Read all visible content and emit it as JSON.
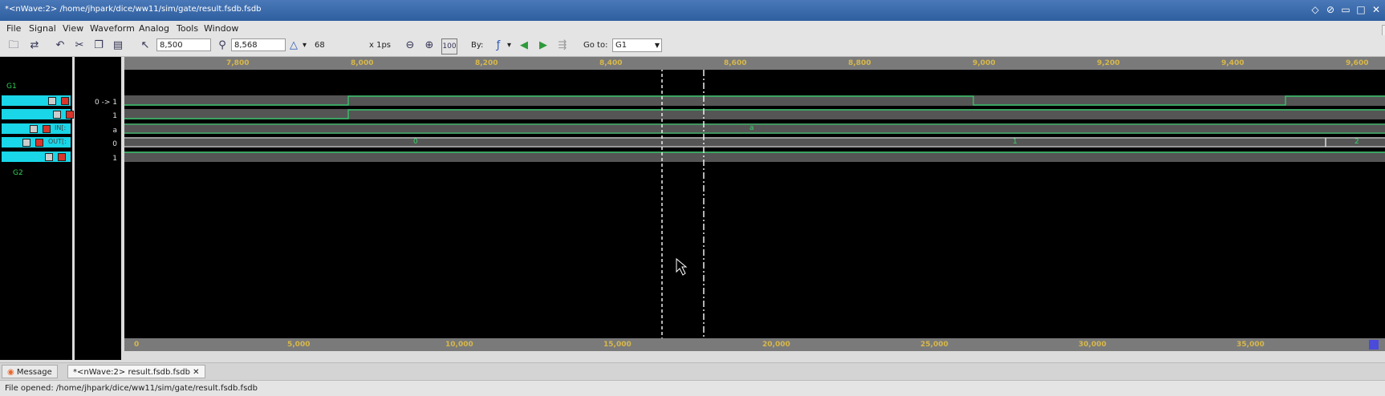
{
  "window": {
    "title": "*<nWave:2> /home/jhpark/dice/ww11/sim/gate/result.fsdb.fsdb"
  },
  "menu": [
    "File",
    "Signal",
    "View",
    "Waveform",
    "Analog",
    "Tools",
    "Window"
  ],
  "toolbar": {
    "cursor_time": "8,500",
    "marker_time": "8,568",
    "delta": "68",
    "time_unit": "x 1ps",
    "by_label": "By:",
    "goto_label": "Go to:",
    "goto_value": "G1"
  },
  "signals": {
    "group1": "G1",
    "group2": "G2",
    "row_labels": [
      "",
      "",
      "",
      "IN[:",
      "OUT[:",
      ""
    ],
    "values": [
      "0 -> 1",
      "1",
      "a",
      "0",
      "1"
    ]
  },
  "ruler_top": [
    "7,800",
    "8,000",
    "8,200",
    "8,400",
    "8,600",
    "8,800",
    "9,000",
    "9,200",
    "9,400",
    "9,600"
  ],
  "ruler_bottom": [
    "0",
    "5,000",
    "10,000",
    "15,000",
    "20,000",
    "25,000",
    "30,000",
    "35,000"
  ],
  "wave_texts": {
    "bus_a": "a",
    "out_0": "0",
    "out_1": "1",
    "out_2": "2"
  },
  "tabs": {
    "message": "Message",
    "file_tab": "*<nWave:2> result.fsdb.fsdb"
  },
  "status": "File opened: /home/jhpark/dice/ww11/sim/gate/result.fsdb.fsdb"
}
